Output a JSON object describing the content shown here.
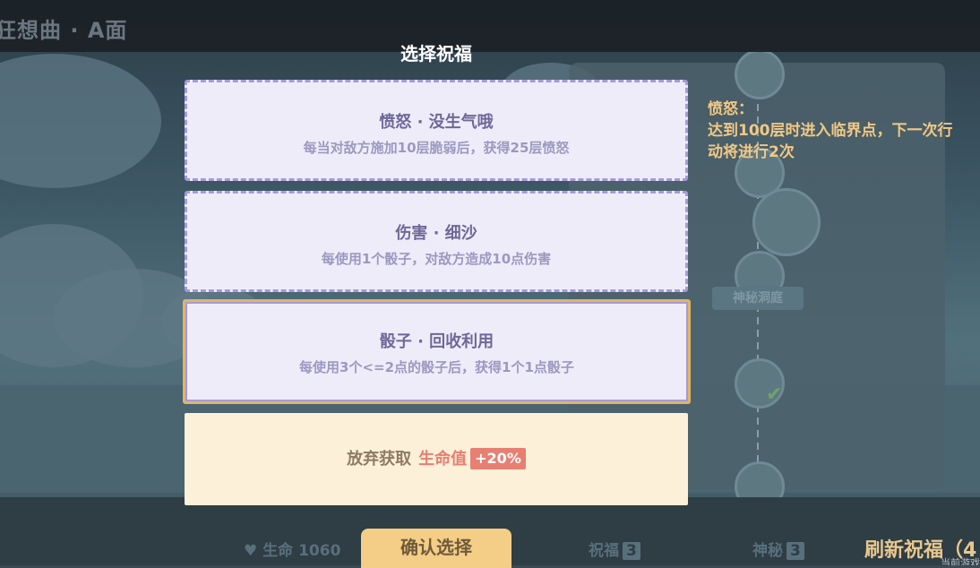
{
  "background": {
    "game_title": "狂想曲 · A面",
    "node_label": "神秘洞庭",
    "stats": {
      "health_label": "生命 1060",
      "blessing_label": "祝福",
      "blessing_count": "3",
      "mystery_label": "神秘",
      "mystery_count": "3"
    },
    "refresh_label": "刷新祝福（4",
    "corner_text": "当前游戏"
  },
  "dialog": {
    "title": "选择祝福",
    "cards": [
      {
        "title": "愤怒 · 没生气哦",
        "desc": "每当对敌方施加10层脆弱后，获得25层愤怒",
        "selected": false
      },
      {
        "title": "伤害 · 细沙",
        "desc": "每使用1个骰子，对敌方造成10点伤害",
        "selected": false
      },
      {
        "title": "骰子 · 回收利用",
        "desc": "每使用3个<=2点的骰子后，获得1个1点骰子",
        "selected": true
      }
    ],
    "forgo": {
      "text": "放弃获取",
      "reward": "生命值",
      "badge": "+20%"
    },
    "confirm_label": "确认选择"
  },
  "tooltip": {
    "heading": "愤怒：",
    "body": "达到100层时进入临界点，下一次行动将进行2次"
  },
  "colors": {
    "card_bg": "#eeecf9",
    "card_border": "#a59ad8",
    "selected_border": "#e1b566",
    "forgo_bg": "#fcf0d8",
    "accent_red": "#e77f73",
    "tooltip_text": "#f2c883",
    "confirm_bg": "#f4cd86"
  }
}
